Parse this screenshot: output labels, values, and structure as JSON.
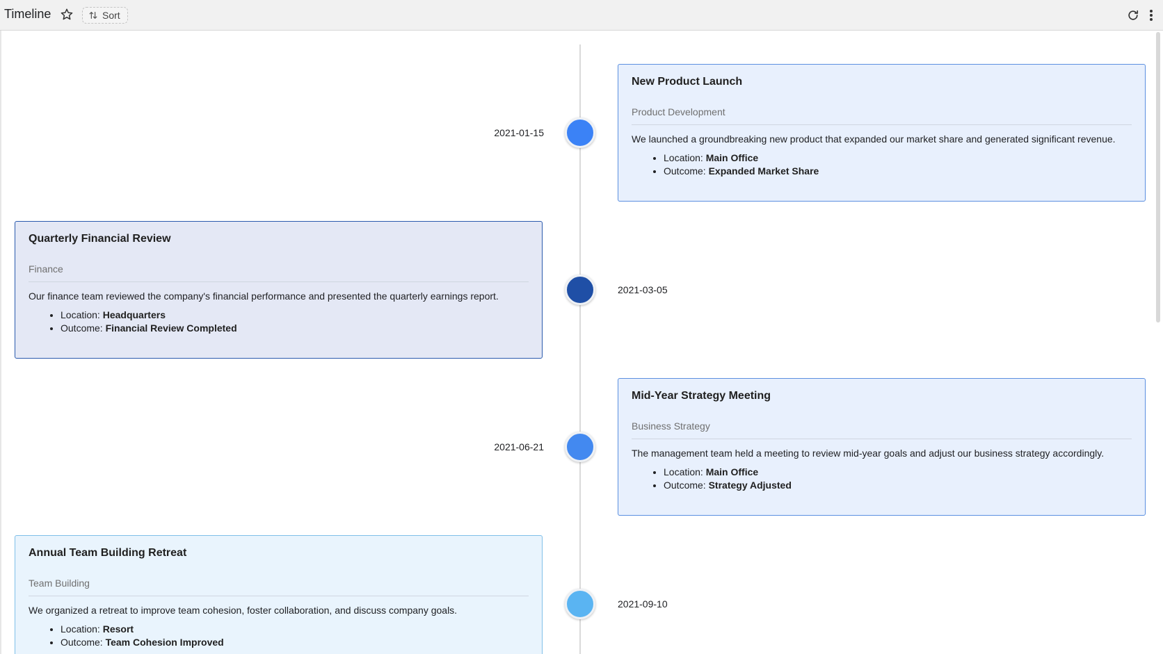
{
  "toolbar": {
    "title": "Timeline",
    "sort_label": "Sort",
    "icons": [
      "star-icon",
      "sort-icon",
      "refresh-icon",
      "more-vert-icon"
    ]
  },
  "events": [
    {
      "date": "2021-01-15",
      "title": "New Product Launch",
      "category": "Product Development",
      "description": "We launched a groundbreaking new product that expanded our market share and generated significant revenue.",
      "location_label": "Location:",
      "location": "Main Office",
      "outcome_label": "Outcome:",
      "outcome": "Expanded Market Share",
      "dot_color": "#3b82f6",
      "card_bg": "#e8f0fd",
      "card_border": "#5b8fe0"
    },
    {
      "date": "2021-03-05",
      "title": "Quarterly Financial Review",
      "category": "Finance",
      "description": "Our finance team reviewed the company's financial performance and presented the quarterly earnings report.",
      "location_label": "Location:",
      "location": "Headquarters",
      "outcome_label": "Outcome:",
      "outcome": "Financial Review Completed",
      "dot_color": "#1f4fa6",
      "card_bg": "#e4e8f5",
      "card_border": "#2a5aad"
    },
    {
      "date": "2021-06-21",
      "title": "Mid-Year Strategy Meeting",
      "category": "Business Strategy",
      "description": "The management team held a meeting to review mid-year goals and adjust our business strategy accordingly.",
      "location_label": "Location:",
      "location": "Main Office",
      "outcome_label": "Outcome:",
      "outcome": "Strategy Adjusted",
      "dot_color": "#4389f0",
      "card_bg": "#e8f0fd",
      "card_border": "#5b8fe0"
    },
    {
      "date": "2021-09-10",
      "title": "Annual Team Building Retreat",
      "category": "Team Building",
      "description": "We organized a retreat to improve team cohesion, foster collaboration, and discuss company goals.",
      "location_label": "Location:",
      "location": "Resort",
      "outcome_label": "Outcome:",
      "outcome": "Team Cohesion Improved",
      "dot_color": "#5ab4f2",
      "card_bg": "#e9f4fd",
      "card_border": "#7fbfe8"
    }
  ]
}
